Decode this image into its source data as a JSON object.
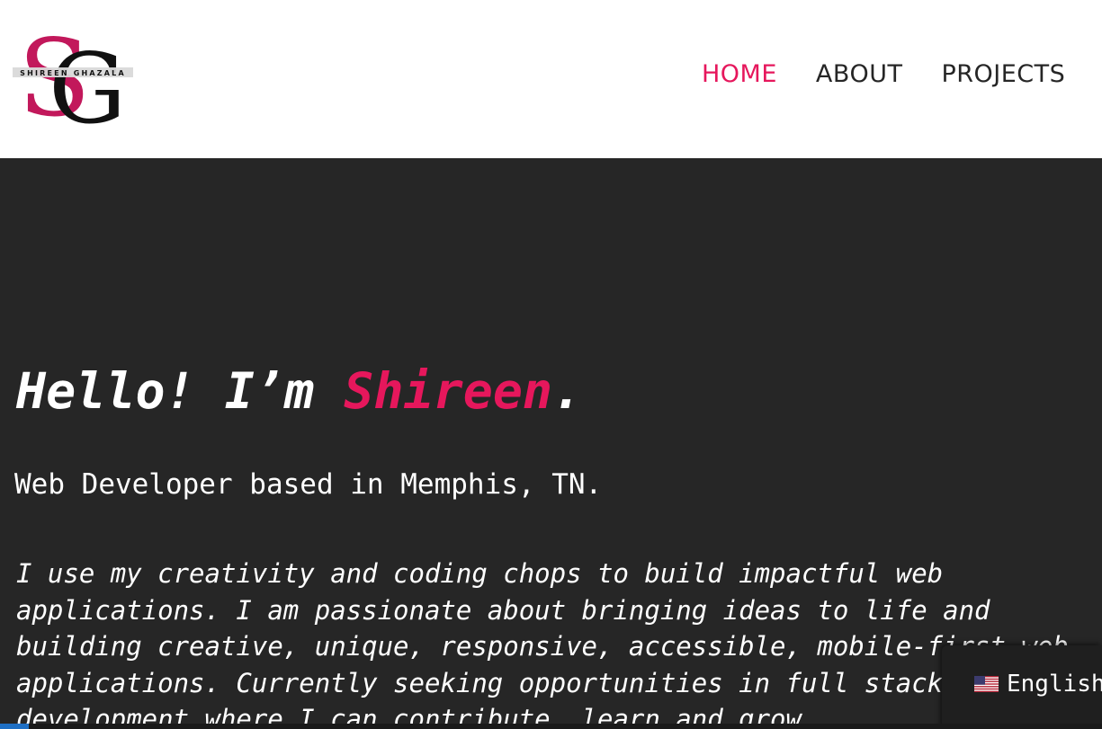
{
  "logo": {
    "monogram_first": "S",
    "monogram_second": "G",
    "name_strip": "SHIREEN GHAZALA",
    "colors": {
      "primary": "#c2185b",
      "secondary": "#111111"
    }
  },
  "nav": {
    "items": [
      {
        "label": "HOME",
        "active": true
      },
      {
        "label": "ABOUT",
        "active": false
      },
      {
        "label": "PROJECTS",
        "active": false
      }
    ]
  },
  "hero": {
    "greeting_prefix": "Hello! I’m ",
    "greeting_name": "Shireen",
    "greeting_suffix": ".",
    "subtitle": "Web Developer based in Memphis, TN.",
    "bio_lines": [
      "I use my creativity and coding chops to build impactful web",
      "applications. I am passionate about bringing ideas to life and",
      "building creative, unique, responsive, accessible, mobile-first web",
      "applications. Currently seeking opportunities in full stack",
      "development where I can contribute, learn and grow."
    ]
  },
  "language_switcher": {
    "label": "English",
    "flag_icon": "us-flag-icon"
  },
  "theme": {
    "accent": "#e6175c",
    "background_dark": "#262626",
    "header_background": "#ffffff",
    "nav_text": "#262626"
  }
}
